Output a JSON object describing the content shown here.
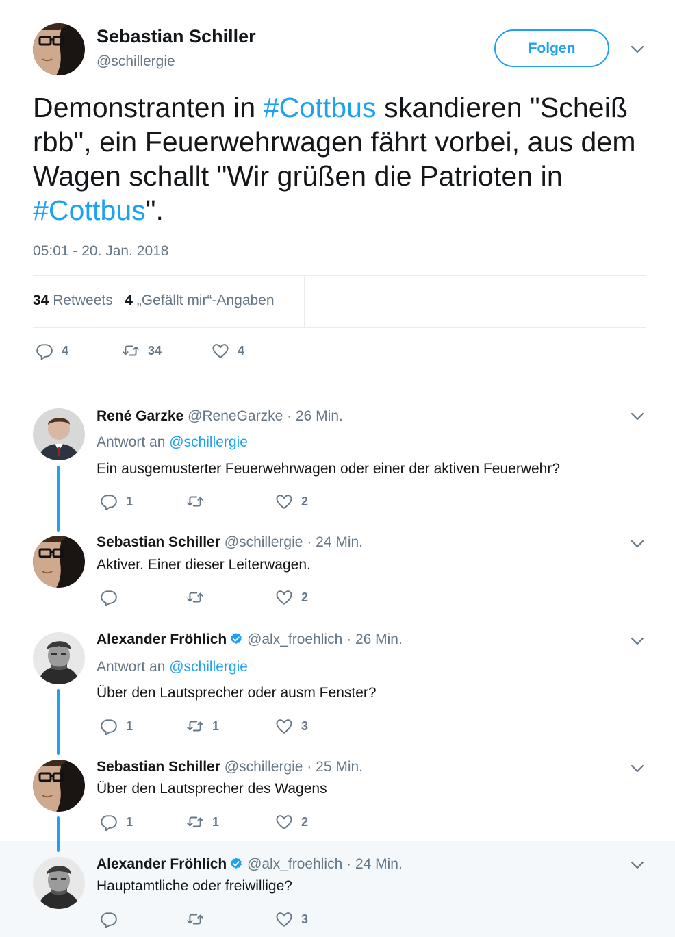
{
  "tweet": {
    "author_name": "Sebastian Schiller",
    "author_handle": "@schillergie",
    "follow_label": "Folgen",
    "text_before_1": "Demonstranten in ",
    "hashtag_1": "#Cottbus",
    "text_middle": " skandieren \"Scheiß rbb\", ein Feuerwehrwagen fährt vorbei, aus dem Wagen schallt \"Wir grüßen die Patrioten in ",
    "hashtag_2": "#Cottbus",
    "text_after": "\".",
    "timestamp": "05:01 - 20. Jan. 2018",
    "retweet_count": "34",
    "retweet_label": "Retweets",
    "like_count": "4",
    "like_label": "„Gefällt mir“-Angaben",
    "actions": {
      "reply": "4",
      "retweet": "34",
      "like": "4"
    }
  },
  "colors": {
    "accent": "#1da1f2",
    "muted": "#657786",
    "text": "#14171a",
    "divider": "#e6ecf0"
  },
  "replies": [
    {
      "name": "René Garzke",
      "handle": "@ReneGarzke",
      "time": "· 26 Min.",
      "reply_to_label": "Antwort an",
      "reply_to_handle": "@schillergie",
      "text": "Ein ausgemusterter Feuerwehrwagen oder einer der aktiven Feuerwehr?",
      "reply": "1",
      "retweet": "",
      "like": "2"
    },
    {
      "name": "Sebastian Schiller",
      "handle": "@schillergie",
      "time": "· 24 Min.",
      "text": "Aktiver. Einer dieser Leiterwagen.",
      "reply": "",
      "retweet": "",
      "like": "2"
    },
    {
      "name": "Alexander Fröhlich",
      "handle": "@alx_froehlich",
      "time": "· 26 Min.",
      "reply_to_label": "Antwort an",
      "reply_to_handle": "@schillergie",
      "text": "Über den Lautsprecher oder ausm Fenster?",
      "reply": "1",
      "retweet": "1",
      "like": "3"
    },
    {
      "name": "Sebastian Schiller",
      "handle": "@schillergie",
      "time": "· 25 Min.",
      "text": "Über den Lautsprecher des Wagens",
      "reply": "1",
      "retweet": "1",
      "like": "2"
    },
    {
      "name": "Alexander Fröhlich",
      "handle": "@alx_froehlich",
      "time": "· 24 Min.",
      "text": "Hauptamtliche oder freiwillige?",
      "reply": "",
      "retweet": "",
      "like": "3"
    }
  ]
}
